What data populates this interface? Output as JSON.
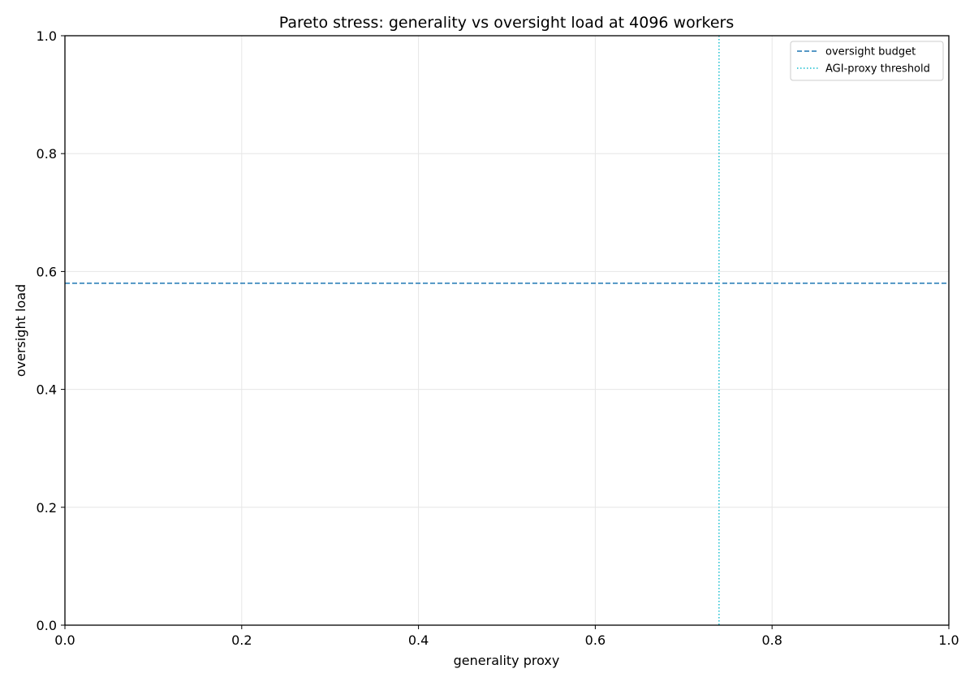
{
  "chart_data": {
    "type": "line",
    "title": "Pareto stress: generality vs oversight load at 4096 workers",
    "xlabel": "generality proxy",
    "ylabel": "oversight load",
    "xlim": [
      0.0,
      1.0
    ],
    "ylim": [
      0.0,
      1.0
    ],
    "xticks": [
      "0.0",
      "0.2",
      "0.4",
      "0.6",
      "0.8",
      "1.0"
    ],
    "yticks": [
      "0.0",
      "0.2",
      "0.4",
      "0.6",
      "0.8",
      "1.0"
    ],
    "grid": true,
    "legend_position": "top-right",
    "series": [
      {
        "name": "oversight budget",
        "kind": "hline",
        "y": 0.58,
        "style": "dashed",
        "color": "#1f77b4"
      },
      {
        "name": "AGI-proxy threshold",
        "kind": "vline",
        "x": 0.74,
        "style": "dotted",
        "color": "#17becf"
      }
    ]
  }
}
